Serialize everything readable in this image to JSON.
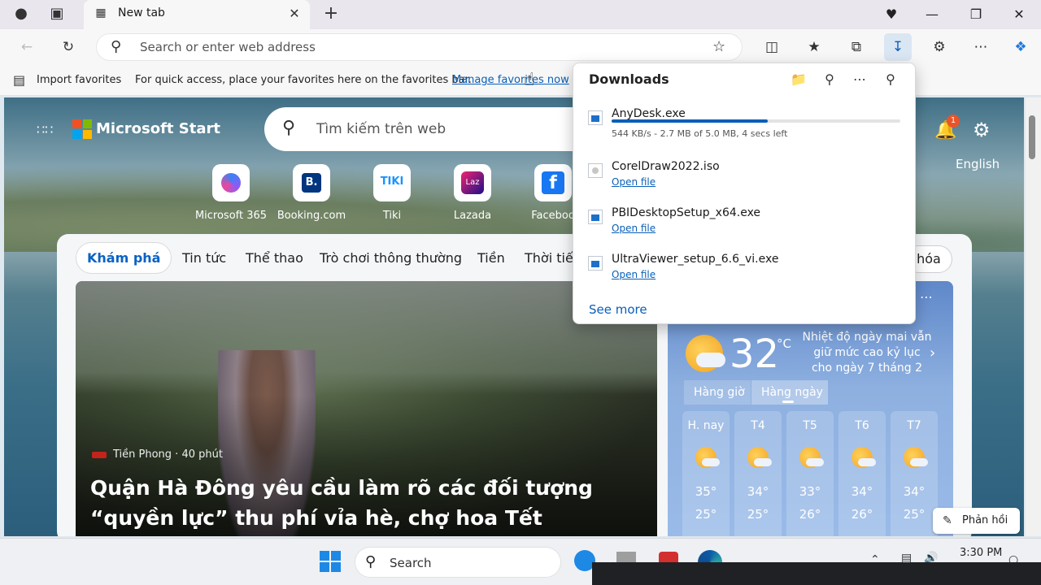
{
  "browser": {
    "tab_title": "New tab",
    "address_placeholder": "Search or enter web address"
  },
  "favorites_bar": {
    "import_label": "Import favorites",
    "hint_text": "For quick access, place your favorites here on the favorites bar.",
    "manage_link": "Manage favorites now"
  },
  "downloads": {
    "title": "Downloads",
    "items": [
      {
        "name": "AnyDesk.exe",
        "status": "544 KB/s - 2.7 MB of 5.0 MB, 4 secs left",
        "progress": 0.54,
        "type": "exe"
      },
      {
        "name": "CorelDraw2022.iso",
        "link": "Open file",
        "type": "iso"
      },
      {
        "name": "PBIDesktopSetup_x64.exe",
        "link": "Open file",
        "type": "exe"
      },
      {
        "name": "UltraViewer_setup_6.6_vi.exe",
        "link": "Open file",
        "type": "exe"
      }
    ],
    "see_more": "See more"
  },
  "start_page": {
    "brand": "Microsoft Start",
    "search_placeholder": "Tìm kiếm trên web",
    "quick_links": [
      {
        "label": "Microsoft 365",
        "icon": "microsoft365-icon"
      },
      {
        "label": "Booking.com",
        "icon": "booking-icon"
      },
      {
        "label": "Tiki",
        "icon": "tiki-icon"
      },
      {
        "label": "Lazada",
        "icon": "lazada-icon"
      },
      {
        "label": "Faceboo",
        "icon": "facebook-icon"
      }
    ],
    "notification_count": "1",
    "language": "English",
    "nav_tabs": [
      "Khám phá",
      "Tin tức",
      "Thể thao",
      "Trò chơi thông thường",
      "Tiền",
      "Thời tiết"
    ],
    "nav_tab_partial": "hóa",
    "hero": {
      "source": "Tiền Phong · 40 phút",
      "headline": "Quận Hà Đông yêu cầu làm rõ các đối tượng “quyền lực” thu phí vỉa hè, chợ hoa Tết"
    },
    "weather": {
      "temperature": "32",
      "unit": "°C",
      "note": "Nhiệt độ ngày mai vẫn giữ mức cao kỷ lục cho ngày 7 tháng 2",
      "tabs": [
        "Hàng giờ",
        "Hàng ngày"
      ],
      "days": [
        {
          "name": "H. nay",
          "hi": "35°",
          "lo": "25°"
        },
        {
          "name": "T4",
          "hi": "34°",
          "lo": "25°"
        },
        {
          "name": "T5",
          "hi": "33°",
          "lo": "26°"
        },
        {
          "name": "T6",
          "hi": "34°",
          "lo": "26°"
        },
        {
          "name": "T7",
          "hi": "34°",
          "lo": "25°"
        }
      ]
    },
    "feedback_label": "Phản hồi"
  },
  "taskbar": {
    "search_label": "Search",
    "time": "3:30 PM"
  }
}
